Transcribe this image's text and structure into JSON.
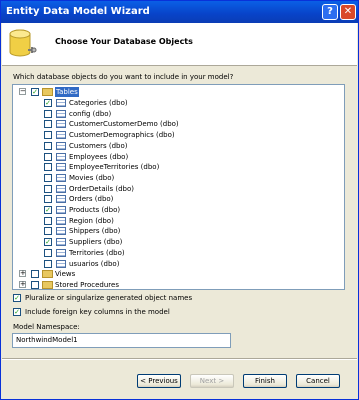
{
  "window": {
    "title": "Entity Data Model Wizard",
    "help_glyph": "?",
    "close_glyph": "✕"
  },
  "header": {
    "title": "Choose Your Database Objects"
  },
  "question": "Which database objects do you want to include in your model?",
  "tree": {
    "tables": {
      "label": "Tables",
      "checked": true,
      "expanded": true
    },
    "items": [
      {
        "label": "Categories (dbo)",
        "checked": true
      },
      {
        "label": "config (dbo)",
        "checked": false
      },
      {
        "label": "CustomerCustomerDemo (dbo)",
        "checked": false
      },
      {
        "label": "CustomerDemographics (dbo)",
        "checked": false
      },
      {
        "label": "Customers (dbo)",
        "checked": false
      },
      {
        "label": "Employees (dbo)",
        "checked": false
      },
      {
        "label": "EmployeeTerritories (dbo)",
        "checked": false
      },
      {
        "label": "Movies (dbo)",
        "checked": false
      },
      {
        "label": "OrderDetails (dbo)",
        "checked": false
      },
      {
        "label": "Orders (dbo)",
        "checked": false
      },
      {
        "label": "Products (dbo)",
        "checked": true
      },
      {
        "label": "Region (dbo)",
        "checked": false
      },
      {
        "label": "Shippers (dbo)",
        "checked": false
      },
      {
        "label": "Suppliers (dbo)",
        "checked": true
      },
      {
        "label": "Territories (dbo)",
        "checked": false
      },
      {
        "label": "usuarios (dbo)",
        "checked": false
      }
    ],
    "views": {
      "label": "Views",
      "checked": false
    },
    "procs": {
      "label": "Stored Procedures",
      "checked": false
    }
  },
  "options": [
    {
      "label": "Pluralize or singularize generated object names",
      "checked": true
    },
    {
      "label": "Include foreign key columns in the model",
      "checked": true
    }
  ],
  "namespace": {
    "label": "Model Namespace:",
    "value": "NorthwindModel1"
  },
  "buttons": {
    "previous": "< Previous",
    "next": "Next >",
    "finish": "Finish",
    "cancel": "Cancel"
  },
  "colors": {
    "title_bar": "#0843c8",
    "selection": "#316ac5",
    "check": "#21a121",
    "dialog": "#ece9d8"
  }
}
